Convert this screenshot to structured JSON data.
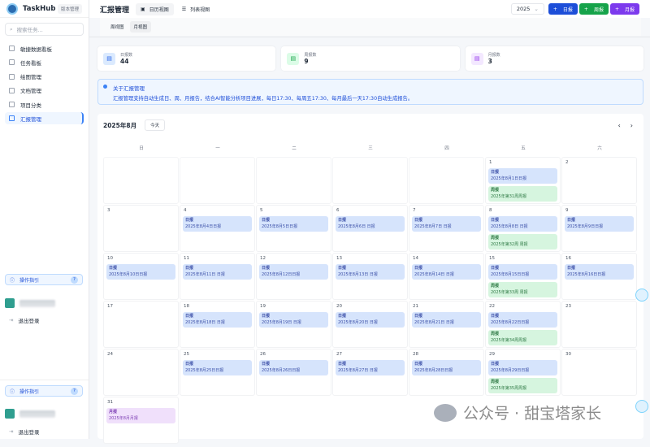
{
  "sidebar": {
    "app_name": "TaskHub",
    "version_badge": "版本管理",
    "search_placeholder": "搜索任务...",
    "items": [
      {
        "label": "敏捷数据看板",
        "icon": "doc-icon"
      },
      {
        "label": "任务看板",
        "icon": "chart-icon"
      },
      {
        "label": "绘图管理",
        "icon": "grid-icon"
      },
      {
        "label": "文档管理",
        "icon": "file-icon"
      },
      {
        "label": "项目分类",
        "icon": "folder-icon"
      },
      {
        "label": "汇报管理",
        "icon": "report-icon",
        "active": true
      }
    ],
    "guide_label": "操作指引",
    "guide_help": "?",
    "logout_label": "退出登录"
  },
  "header": {
    "title": "汇报管理",
    "view_tabs": [
      {
        "label": "日历视图",
        "icon": "calendar-icon",
        "active": true
      },
      {
        "label": "列表视图",
        "icon": "list-icon"
      }
    ],
    "year": "2025",
    "buttons": [
      {
        "label": "日报",
        "color": "#1d4ed8"
      },
      {
        "label": "周报",
        "color": "#16a34a"
      },
      {
        "label": "月报",
        "color": "#7c3aed"
      }
    ]
  },
  "subtabs": [
    {
      "label": "周视图"
    },
    {
      "label": "月视图",
      "active": true
    }
  ],
  "stats": [
    {
      "label": "日报数",
      "value": "44",
      "color": "#dbeafe",
      "fg": "#2563eb"
    },
    {
      "label": "周报数",
      "value": "9",
      "color": "#dcfce7",
      "fg": "#16a34a"
    },
    {
      "label": "月报数",
      "value": "3",
      "color": "#f3e8ff",
      "fg": "#9333ea"
    }
  ],
  "info": {
    "title": "关于汇报管理",
    "desc": "汇报管理支持自动生成日、周、月报告，结合AI智能分析项目进展，每日17:30、每周五17:30、每月最后一天17:30自动生成报告。"
  },
  "calendar": {
    "month_label": "2025年8月",
    "today_label": "今天",
    "prev": "‹",
    "next": "›",
    "weekdays": [
      "日",
      "一",
      "二",
      "三",
      "四",
      "五",
      "六"
    ],
    "first_weekday": 5,
    "days_in_month": 31,
    "events": {
      "1": [
        [
          "daily",
          "日报",
          "2025年8月1日日报"
        ],
        [
          "weekly",
          "周报",
          "2025年第31周周报"
        ]
      ],
      "4": [
        [
          "daily",
          "日报",
          "2025年8月4日日报"
        ]
      ],
      "5": [
        [
          "daily",
          "日报",
          "2025年8月5日日报"
        ]
      ],
      "6": [
        [
          "daily",
          "日报",
          "2025年8月6日 日报"
        ]
      ],
      "7": [
        [
          "daily",
          "日报",
          "2025年8月7日 日报"
        ]
      ],
      "8": [
        [
          "daily",
          "日报",
          "2025年8月8日 日报"
        ],
        [
          "weekly",
          "周报",
          "2025年第32周 周报"
        ]
      ],
      "9": [
        [
          "daily",
          "日报",
          "2025年8月9日日报"
        ]
      ],
      "10": [
        [
          "daily",
          "日报",
          "2025年8月10日日报"
        ]
      ],
      "11": [
        [
          "daily",
          "日报",
          "2025年8月11日 日报"
        ]
      ],
      "12": [
        [
          "daily",
          "日报",
          "2025年8月12日日报"
        ]
      ],
      "13": [
        [
          "daily",
          "日报",
          "2025年8月13日 日报"
        ]
      ],
      "14": [
        [
          "daily",
          "日报",
          "2025年8月14日 日报"
        ]
      ],
      "15": [
        [
          "daily",
          "日报",
          "2025年8月15日日报"
        ],
        [
          "weekly",
          "周报",
          "2025年第33周 周报"
        ]
      ],
      "16": [
        [
          "daily",
          "日报",
          "2025年8月16日日报"
        ]
      ],
      "18": [
        [
          "daily",
          "日报",
          "2025年8月18日 日报"
        ]
      ],
      "19": [
        [
          "daily",
          "日报",
          "2025年8月19日 日报"
        ]
      ],
      "20": [
        [
          "daily",
          "日报",
          "2025年8月20日 日报"
        ]
      ],
      "21": [
        [
          "daily",
          "日报",
          "2025年8月21日 日报"
        ]
      ],
      "22": [
        [
          "daily",
          "日报",
          "2025年8月22日日报"
        ],
        [
          "weekly",
          "周报",
          "2025年第34周周报"
        ]
      ],
      "25": [
        [
          "daily",
          "日报",
          "2025年8月25日日报"
        ]
      ],
      "26": [
        [
          "daily",
          "日报",
          "2025年8月26日日报"
        ]
      ],
      "27": [
        [
          "daily",
          "日报",
          "2025年8月27日 日报"
        ]
      ],
      "28": [
        [
          "daily",
          "日报",
          "2025年8月28日日报"
        ]
      ],
      "29": [
        [
          "daily",
          "日报",
          "2025年8月29日日报"
        ],
        [
          "weekly",
          "周报",
          "2025年第35周周报"
        ]
      ],
      "31": [
        [
          "monthly",
          "月报",
          "2025年8月月报"
        ]
      ]
    }
  },
  "watermark": "公众号 · 甜宝塔家长"
}
